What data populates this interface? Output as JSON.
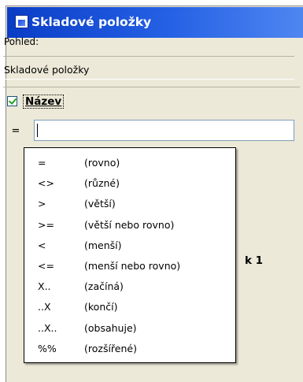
{
  "window": {
    "title": "Skladové položky"
  },
  "view": {
    "label": "Pohled:",
    "value": "Skladové položky"
  },
  "filter": {
    "field_label": "Název",
    "checked": true,
    "operator": "=",
    "value": ""
  },
  "background": {
    "partial_text": "k 1"
  },
  "operator_menu": {
    "items": [
      {
        "symbol": "=",
        "description": "(rovno)"
      },
      {
        "symbol": "<>",
        "description": "(různé)"
      },
      {
        "symbol": ">",
        "description": "(větší)"
      },
      {
        "symbol": ">=",
        "description": "(větší nebo rovno)"
      },
      {
        "symbol": "<",
        "description": "(menší)"
      },
      {
        "symbol": "<=",
        "description": "(menší nebo rovno)"
      },
      {
        "symbol": "X..",
        "description": "(začíná)"
      },
      {
        "symbol": "..X",
        "description": "(končí)"
      },
      {
        "symbol": "..X..",
        "description": "(obsahuje)"
      },
      {
        "symbol": "%%",
        "description": "(rozšířené)"
      }
    ]
  },
  "colors": {
    "titlebar": "#2561e5",
    "panel": "#ece9d8",
    "check": "#21a121"
  }
}
